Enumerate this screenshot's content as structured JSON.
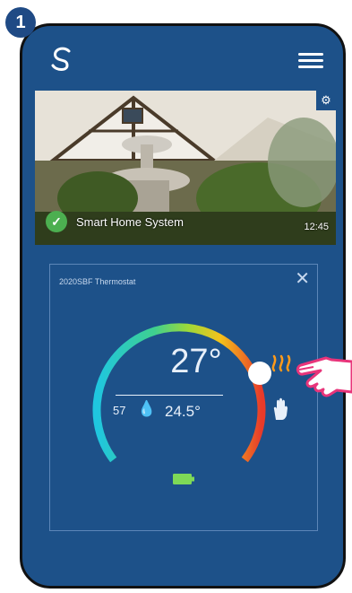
{
  "step": {
    "number": "1"
  },
  "app": {
    "logo_icon": "salus-logo-icon",
    "menu_icon": "hamburger-menu-icon"
  },
  "camera": {
    "name": "Smart Home System",
    "time": "12:45",
    "status_icon": "check-icon",
    "settings_icon": "gear-icon"
  },
  "thermostat": {
    "title": "2020SBF Thermostat",
    "set_temperature": "27°",
    "humidity": "57",
    "current_temperature": "24.5°",
    "mode_icons": [
      "heating-icon",
      "manual-mode-icon"
    ],
    "battery_icon": "battery-icon",
    "close_icon": "close-icon",
    "colors": {
      "background": "#1d5189",
      "gauge_start": "#1fc6e0",
      "gauge_mid": "#9bd93a",
      "gauge_warm": "#f5c21b",
      "gauge_end": "#e83a2a",
      "heat": "#ff9a1a",
      "battery": "#7ed957"
    }
  },
  "pointer": {
    "icon": "pointing-hand-icon"
  }
}
